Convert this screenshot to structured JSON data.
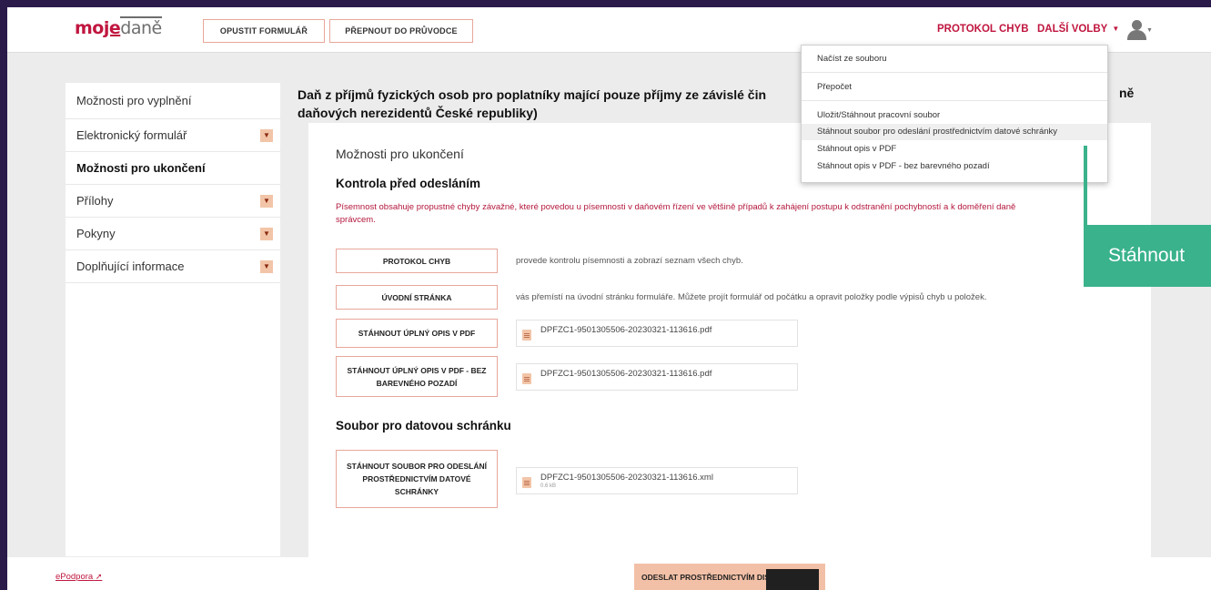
{
  "brand": {
    "logo_prefix": "mo",
    "logo_underlined": "je",
    "logo_suffix": "daně"
  },
  "topbar": {
    "leave_form": "OPUSTIT FORMULÁŘ",
    "switch_guide": "PŘEPNOUT DO PRŮVODCE",
    "error_protocol": "PROTOKOL CHYB",
    "more_options": "DALŠÍ VOLBY"
  },
  "sidebar": {
    "items": [
      {
        "label": "Možnosti pro vyplnění",
        "expandable": false,
        "active": false
      },
      {
        "label": "Elektronický formulář",
        "expandable": true,
        "active": false
      },
      {
        "label": "Možnosti pro ukončení",
        "expandable": false,
        "active": true
      },
      {
        "label": "Přílohy",
        "expandable": true,
        "active": false
      },
      {
        "label": "Pokyny",
        "expandable": true,
        "active": false
      },
      {
        "label": "Doplňující informace",
        "expandable": true,
        "active": false
      }
    ]
  },
  "page": {
    "title": "Daň z příjmů fyzických osob pro poplatníky mající pouze příjmy ze závislé čin",
    "title_line2": "daňových nerezidentů České republiky)",
    "title_tail": "ně"
  },
  "panel": {
    "subtitle": "Možnosti pro ukončení",
    "check_heading": "Kontrola před odesláním",
    "warning": "Písemnost obsahuje propustné chyby závažné, které povedou u písemnosti v daňovém řízení ve většině případů k zahájení postupu k odstranění pochybností a k doměření daně správcem.",
    "actions": [
      {
        "label": "PROTOKOL CHYB",
        "desc": "provede kontrolu písemnosti a zobrazí seznam všech chyb."
      },
      {
        "label": "ÚVODNÍ STRÁNKA",
        "desc": "vás přemístí na úvodní stránku formuláře. Můžete projít formulář od počátku a opravit položky podle výpisů chyb u položek."
      },
      {
        "label": "STÁHNOUT ÚPLNÝ OPIS V PDF",
        "file": "DPFZC1-9501305506-20230321-113616.pdf"
      },
      {
        "label": "STÁHNOUT ÚPLNÝ OPIS V PDF - BEZ BAREVNÉHO POZADÍ",
        "file": "DPFZC1-9501305506-20230321-113616.pdf"
      }
    ],
    "databox_heading": "Soubor pro datovou schránku",
    "databox_action": {
      "label": "STÁHNOUT SOUBOR PRO ODESLÁNÍ PROSTŘEDNICTVÍM DATOVÉ SCHRÁNKY",
      "file": "DPFZC1-9501305506-20230321-113616.xml",
      "size": "0.6 kB"
    }
  },
  "dropdown": {
    "items": [
      "Načíst ze souboru",
      "Přepočet",
      "Uložit/Stáhnout pracovní soubor",
      "Stáhnout soubor pro odeslání prostřednictvím datové schránky",
      "Stáhnout opis v PDF",
      "Stáhnout opis v PDF - bez barevného pozadí"
    ],
    "highlighted_index": 3
  },
  "callout": {
    "text": "Stáhnout"
  },
  "footer": {
    "support_link": "ePodpora",
    "send_button": "ODESLAT PROSTŘEDNICTVÍM DIS+"
  },
  "colors": {
    "brand": "#c0163f",
    "accent_orange": "#f2c0a6",
    "callout_green": "#3ab28c"
  }
}
